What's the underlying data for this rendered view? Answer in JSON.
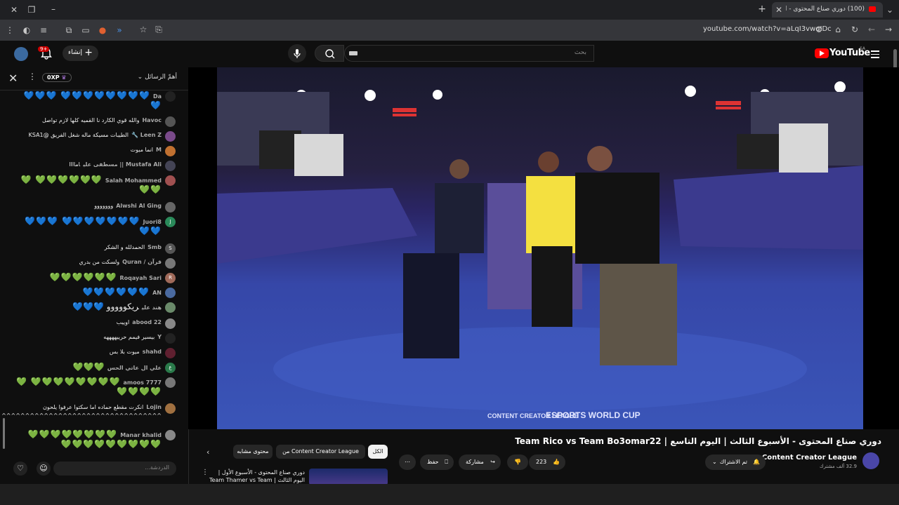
{
  "browser": {
    "tab_title": "(100) دوري صناع المحتوى - ا...",
    "url": "youtube.com/watch?v=aLqI3vwqIDc"
  },
  "header": {
    "search_placeholder": "بحث",
    "create_label": "إنشاء",
    "notifications": "9+",
    "logo_text": "YouTube",
    "region": "SA"
  },
  "chat": {
    "title": "أهمّ الرسائل",
    "xp_badge": "0XP",
    "input_placeholder": "الدردشة...",
    "messages": [
      {
        "author": "Da",
        "text": "💙💙💙💙💙💙💙💙 💙💙💙💙",
        "hearts": "blue",
        "av": "#222"
      },
      {
        "author": "Havoc",
        "text": "والله قوي الكارد نا القميه كلها لازم تواصل",
        "av": "#555"
      },
      {
        "author": "Leen Z 🔧",
        "text": "الطيبات مسيكة ماله شغل الفريق @KSA1",
        "av": "#7a4a8a"
      },
      {
        "author": "M",
        "text": "انما ميوت",
        "av": "#c07030"
      },
      {
        "author": "Mustafa Ali || مسطفى علي",
        "text": "اماااا",
        "av": "#445"
      },
      {
        "author": "Salah Mohammed",
        "text": "💚💚💚💚💚💚 💚💚💚",
        "hearts": "green",
        "av": "#a05050"
      },
      {
        "author": "Alwshi Al Ging",
        "text": "ووووووو",
        "av": "#666"
      },
      {
        "author": "Juori8",
        "text": "💙💙💙💙💙💙💙 💙💙💙💙💙",
        "hearts": "blue",
        "av": "#2a8a5a",
        "letter": "J"
      },
      {
        "author": "Smb",
        "text": "الحمدلله و الشكر",
        "av": "#555",
        "letter": "S"
      },
      {
        "author": "قرآن / Quran",
        "text": "ولسكت من بدري",
        "av": "#777"
      },
      {
        "author": "Roqayah Sari",
        "text": "💚💚💚💚💚💚",
        "hearts": "green",
        "av": "#a06a5a",
        "letter": "R"
      },
      {
        "author": "AN",
        "text": "💙💙💙💙💙💙",
        "hearts": "blue",
        "av": "#4a6aa0"
      },
      {
        "author": "هند علي",
        "text": "ريكووووو 💙💙💙",
        "hearts": "blue",
        "av": "#6a8a6a"
      },
      {
        "author": "abood 22",
        "text": "اوييب",
        "av": "#888"
      },
      {
        "author": "Y",
        "text": "بيسير فيمم حرييههههه",
        "av": "#222"
      },
      {
        "author": "shahd",
        "text": "ميوت بلا بس",
        "av": "#602030"
      },
      {
        "author": "علي ال عاتي الحس",
        "text": "💚💚💚",
        "hearts": "green",
        "av": "#2a7a4a",
        "letter": "ع"
      },
      {
        "author": "amoos 7777",
        "text": "💚💚💚💚💚💚💚💚 💚💚💚💚💚",
        "hearts": "green",
        "av": "#777"
      },
      {
        "author": "Lojin",
        "text": "انكرت مقطع حماده اما سكتوا عرفوا يلحون ^^^^^^^^^^^^^^^^^^^^^^^^^^^^^^^^^^",
        "av": "#a07040"
      },
      {
        "author": "Manar khalid",
        "text": "💚💚💚💚💚💚💚💚 💚💚💚💚💚💚💚💚💚",
        "hearts": "green",
        "av": "#888"
      }
    ]
  },
  "video": {
    "title": "دوري صناع المحتوى - الأسبوع الثالث | اليوم التاسع | Team Rico vs Team Bo3omar22",
    "channel": "Content Creator League",
    "subscribers": "32.9 ألف مشترك",
    "subscribed_label": "تم الاشتراك",
    "likes": "223",
    "share_label": "مشاركة",
    "save_label": "حفظ",
    "watermark_left": "CONTENT CREATOR LEAGUE",
    "watermark_right": "ESPORTS WORLD CUP"
  },
  "related": {
    "chips": [
      "الكل",
      "من Content Creator League",
      "محتوى مشابه"
    ],
    "first_title": "دوري صناع المحتوى - الأسبوع الأول | اليوم الثالث | Team Thamer vs Team"
  }
}
